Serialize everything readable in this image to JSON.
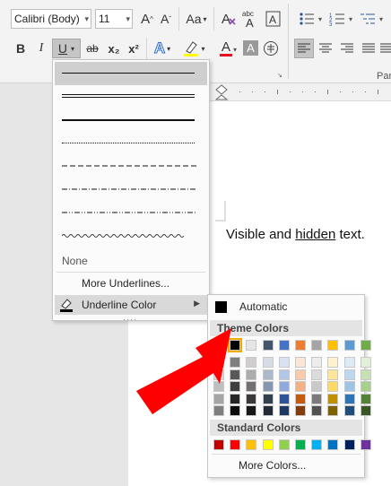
{
  "ribbon": {
    "font_name": "Calibri (Body)",
    "font_size": "11",
    "grow_font_label": "A^",
    "shrink_font_label": "Aˇ",
    "change_case_label": "Aa",
    "clear_format_icon": "clear-formatting-icon",
    "abc_label": "abc",
    "bold_label": "B",
    "italic_label": "I",
    "underline_label": "U",
    "strikethrough_label": "ab",
    "subscript_label": "x₂",
    "superscript_label": "x²",
    "text_effects_label": "A",
    "highlight_color": "#ffff00",
    "font_color_label": "A",
    "font_color": "#e81123",
    "char_shading_label": "A",
    "paragraph_group_label": "Par"
  },
  "underline_menu": {
    "styles": [
      "single",
      "double",
      "thick",
      "dotted",
      "dashed",
      "dash-dot",
      "dash-dot-dot",
      "wave"
    ],
    "selected_index": 0,
    "none_label": "None",
    "more_label": "More Underlines...",
    "color_label": "Underline Color"
  },
  "palette": {
    "automatic_label": "Automatic",
    "theme_header": "Theme Colors",
    "standard_header": "Standard Colors",
    "more_colors_label": "More Colors...",
    "theme_top": [
      "#ffffff",
      "#000000",
      "#e7e6e6",
      "#44546a",
      "#4472c4",
      "#ed7d31",
      "#a5a5a5",
      "#ffc000",
      "#5b9bd5",
      "#70ad47"
    ],
    "theme_shades": [
      [
        "#f2f2f2",
        "#7f7f7f",
        "#d0cece",
        "#d6dce4",
        "#d9e2f3",
        "#fbe5d5",
        "#ededed",
        "#fff2cc",
        "#deebf6",
        "#e2efd9"
      ],
      [
        "#d8d8d8",
        "#595959",
        "#aeabab",
        "#adb9ca",
        "#b4c6e7",
        "#f7cbac",
        "#dbdbdb",
        "#fee599",
        "#bdd7ee",
        "#c5e0b3"
      ],
      [
        "#bfbfbf",
        "#3f3f3f",
        "#757070",
        "#8496b0",
        "#8eaadb",
        "#f4b183",
        "#c9c9c9",
        "#ffd965",
        "#9dc3e6",
        "#a8d08d"
      ],
      [
        "#a5a5a5",
        "#262626",
        "#3a3838",
        "#323f4f",
        "#2f5496",
        "#c55a11",
        "#7b7b7b",
        "#bf9000",
        "#2e75b5",
        "#538135"
      ],
      [
        "#7f7f7f",
        "#0c0c0c",
        "#171616",
        "#222a35",
        "#1f3864",
        "#843c0b",
        "#525252",
        "#7f6000",
        "#1e4e79",
        "#375623"
      ]
    ],
    "standard": [
      "#c00000",
      "#ff0000",
      "#ffc000",
      "#ffff00",
      "#92d050",
      "#00b050",
      "#00b0f0",
      "#0070c0",
      "#002060",
      "#7030a0"
    ],
    "selected_theme": "#000000"
  },
  "document": {
    "text_before": "Visible and ",
    "text_underlined": "hidden",
    "text_after": " text."
  },
  "annotation": {
    "arrow_color": "#ff0000"
  }
}
